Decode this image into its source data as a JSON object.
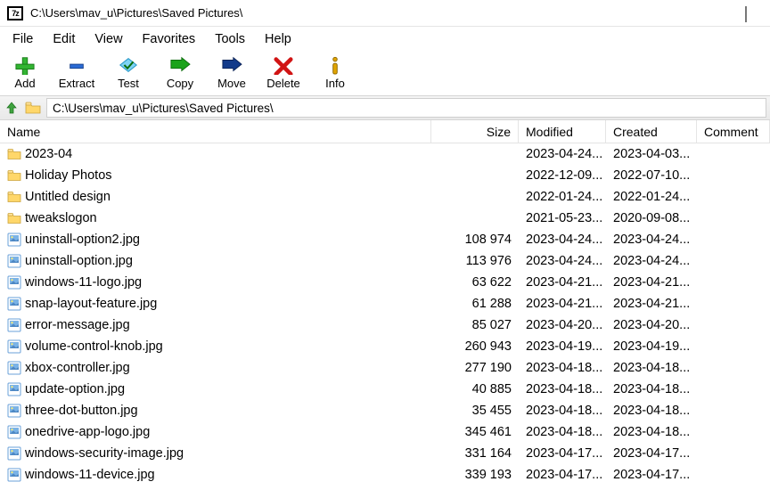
{
  "window": {
    "title": "C:\\Users\\mav_u\\Pictures\\Saved Pictures\\",
    "app_icon_text": "7z"
  },
  "menu": {
    "items": [
      "File",
      "Edit",
      "View",
      "Favorites",
      "Tools",
      "Help"
    ]
  },
  "toolbar": {
    "buttons": [
      {
        "id": "add",
        "label": "Add"
      },
      {
        "id": "extract",
        "label": "Extract"
      },
      {
        "id": "test",
        "label": "Test"
      },
      {
        "id": "copy",
        "label": "Copy"
      },
      {
        "id": "move",
        "label": "Move"
      },
      {
        "id": "delete",
        "label": "Delete"
      },
      {
        "id": "info",
        "label": "Info"
      }
    ]
  },
  "address": {
    "path": "C:\\Users\\mav_u\\Pictures\\Saved Pictures\\"
  },
  "columns": {
    "name": "Name",
    "size": "Size",
    "modified": "Modified",
    "created": "Created",
    "comment": "Comment"
  },
  "files": [
    {
      "type": "folder",
      "name": "2023-04",
      "size": "",
      "modified": "2023-04-24...",
      "created": "2023-04-03..."
    },
    {
      "type": "folder",
      "name": "Holiday Photos",
      "size": "",
      "modified": "2022-12-09...",
      "created": "2022-07-10..."
    },
    {
      "type": "folder",
      "name": "Untitled design",
      "size": "",
      "modified": "2022-01-24...",
      "created": "2022-01-24..."
    },
    {
      "type": "folder",
      "name": "tweakslogon",
      "size": "",
      "modified": "2021-05-23...",
      "created": "2020-09-08..."
    },
    {
      "type": "image",
      "name": "uninstall-option2.jpg",
      "size": "108 974",
      "modified": "2023-04-24...",
      "created": "2023-04-24..."
    },
    {
      "type": "image",
      "name": "uninstall-option.jpg",
      "size": "113 976",
      "modified": "2023-04-24...",
      "created": "2023-04-24..."
    },
    {
      "type": "image",
      "name": "windows-11-logo.jpg",
      "size": "63 622",
      "modified": "2023-04-21...",
      "created": "2023-04-21..."
    },
    {
      "type": "image",
      "name": "snap-layout-feature.jpg",
      "size": "61 288",
      "modified": "2023-04-21...",
      "created": "2023-04-21..."
    },
    {
      "type": "image",
      "name": "error-message.jpg",
      "size": "85 027",
      "modified": "2023-04-20...",
      "created": "2023-04-20..."
    },
    {
      "type": "image",
      "name": "volume-control-knob.jpg",
      "size": "260 943",
      "modified": "2023-04-19...",
      "created": "2023-04-19..."
    },
    {
      "type": "image",
      "name": "xbox-controller.jpg",
      "size": "277 190",
      "modified": "2023-04-18...",
      "created": "2023-04-18..."
    },
    {
      "type": "image",
      "name": "update-option.jpg",
      "size": "40 885",
      "modified": "2023-04-18...",
      "created": "2023-04-18..."
    },
    {
      "type": "image",
      "name": "three-dot-button.jpg",
      "size": "35 455",
      "modified": "2023-04-18...",
      "created": "2023-04-18..."
    },
    {
      "type": "image",
      "name": "onedrive-app-logo.jpg",
      "size": "345 461",
      "modified": "2023-04-18...",
      "created": "2023-04-18..."
    },
    {
      "type": "image",
      "name": "windows-security-image.jpg",
      "size": "331 164",
      "modified": "2023-04-17...",
      "created": "2023-04-17..."
    },
    {
      "type": "image",
      "name": "windows-11-device.jpg",
      "size": "339 193",
      "modified": "2023-04-17...",
      "created": "2023-04-17..."
    }
  ]
}
